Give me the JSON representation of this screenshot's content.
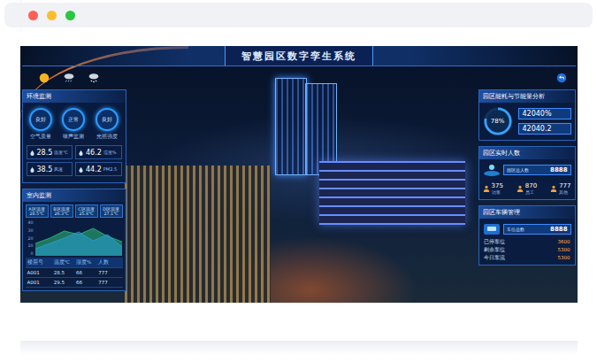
{
  "browser": {
    "dots": [
      {
        "color": "#fe5f57"
      },
      {
        "color": "#febc2e"
      },
      {
        "color": "#28c840"
      }
    ]
  },
  "title": "智慧园区数字孪生系统",
  "weather": [
    {
      "kind": "sun"
    },
    {
      "kind": "rain"
    },
    {
      "kind": "snow"
    }
  ],
  "env": {
    "title": "环境监测",
    "gauges": [
      {
        "value": "良好",
        "label": "空气质量"
      },
      {
        "value": "正常",
        "label": "噪声监测"
      },
      {
        "value": "良好",
        "label": "光照强度"
      }
    ],
    "readings": [
      {
        "value": "28.5",
        "unit": "温度℃"
      },
      {
        "value": "46.2",
        "unit": "湿度%"
      },
      {
        "value": "38.5",
        "unit": "风速"
      },
      {
        "value": "44.2",
        "unit": "PM2.5"
      }
    ]
  },
  "indoor": {
    "title": "室内监测",
    "legend": [
      {
        "label": "A区温度",
        "value": "28.5℃"
      },
      {
        "label": "B区温度",
        "value": "26.3℃"
      },
      {
        "label": "C区温度",
        "value": "25.8℃"
      },
      {
        "label": "D区温度",
        "value": "27.1℃"
      }
    ],
    "chart": {
      "y_ticks": [
        "40",
        "30",
        "20",
        "10",
        "0"
      ],
      "series": [
        {
          "color": "#2fbf7a",
          "values": [
            14,
            20,
            28,
            24,
            31,
            22,
            16
          ]
        },
        {
          "color": "#2a9fd6",
          "values": [
            8,
            14,
            20,
            27,
            17,
            24,
            10
          ]
        }
      ]
    },
    "table": {
      "columns": [
        "楼层号",
        "温度℃",
        "湿度%",
        "人数"
      ],
      "rows": [
        [
          "A001",
          "28.5",
          "66",
          "777"
        ],
        [
          "A001",
          "29.5",
          "66",
          "777"
        ]
      ]
    }
  },
  "energy": {
    "title": "园区能耗与节能量分析",
    "ring": {
      "level": 0.78,
      "reading": "78%"
    },
    "values": [
      "42040%",
      "42040.2"
    ]
  },
  "people": {
    "title": "园区实时人数",
    "total": {
      "label": "园区总人数",
      "value": "8888"
    },
    "stats": [
      {
        "value": "375",
        "label": "访客"
      },
      {
        "value": "870",
        "label": "员工"
      },
      {
        "value": "777",
        "label": "其他"
      }
    ]
  },
  "vehicles": {
    "title": "园区车辆管理",
    "total": {
      "label": "车位总数",
      "value": "8888"
    },
    "rows": [
      {
        "label": "已停车位",
        "value": "3600"
      },
      {
        "label": "剩余车位",
        "value": "5300"
      },
      {
        "label": "今日车流",
        "value": "5300"
      }
    ]
  }
}
